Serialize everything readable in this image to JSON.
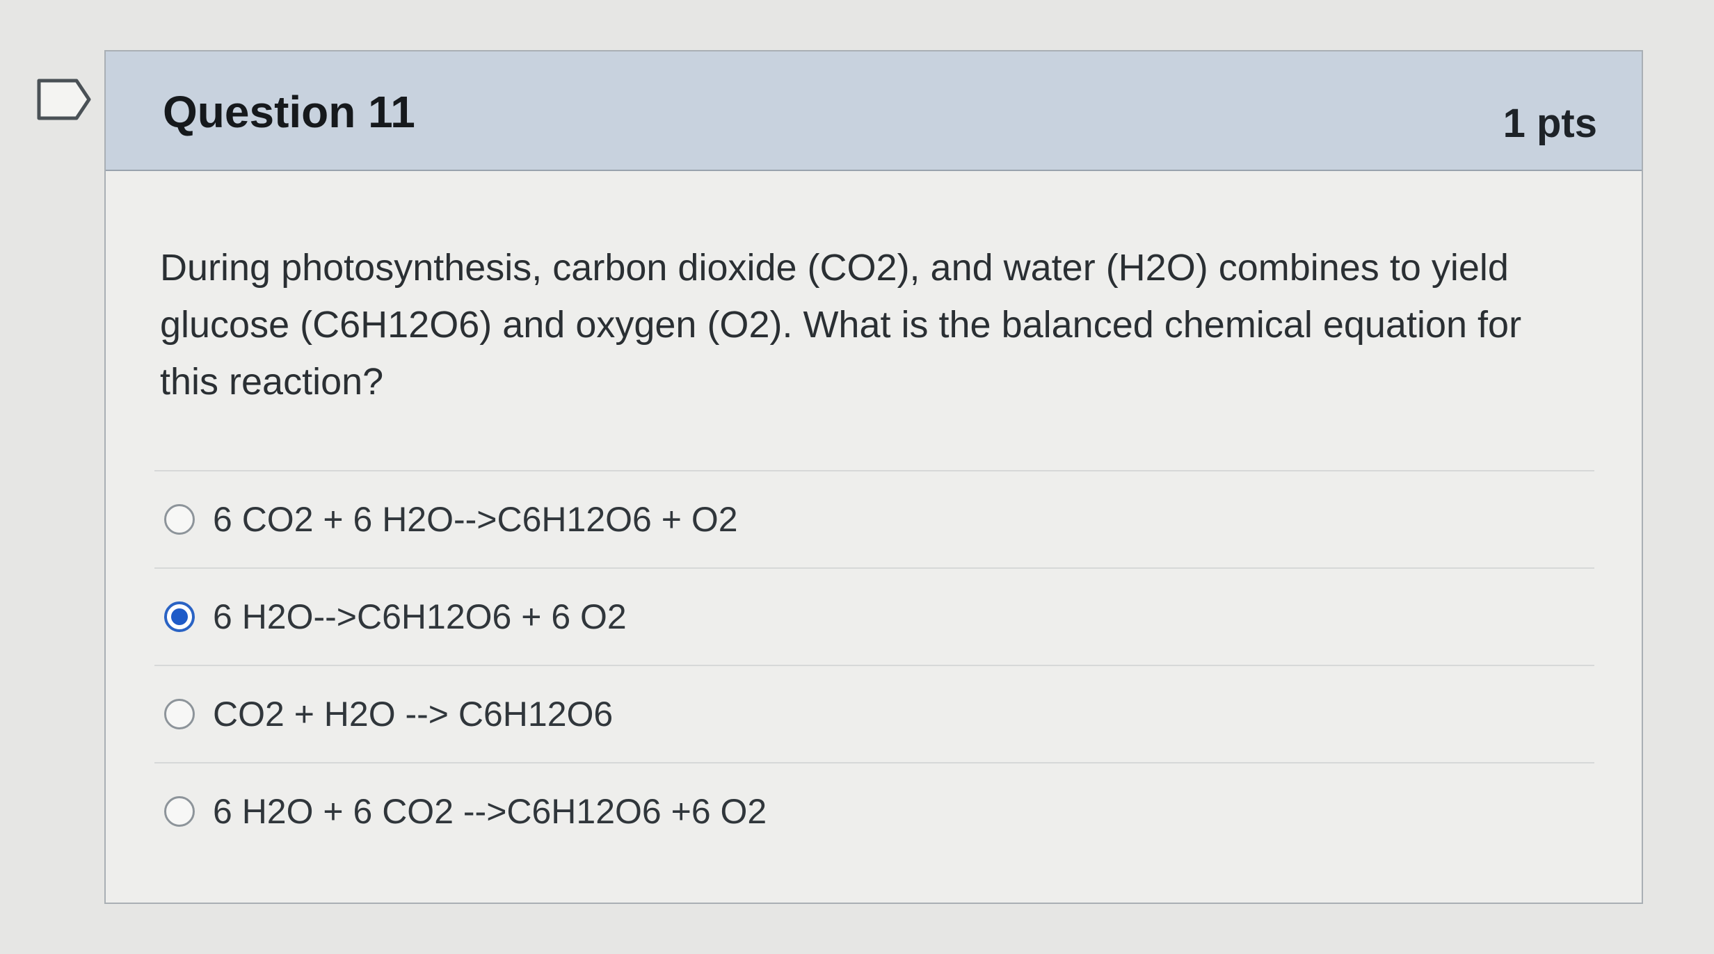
{
  "question": {
    "title": "Question 11",
    "points": "1 pts",
    "text": "During photosynthesis, carbon dioxide (CO2), and water (H2O) combines to yield glucose (C6H12O6) and oxygen (O2). What is the balanced chemical equation for this reaction?",
    "answers": [
      {
        "label": "6 CO2 + 6 H2O-->C6H12O6 + O2",
        "selected": false
      },
      {
        "label": "6 H2O-->C6H12O6 + 6 O2",
        "selected": true
      },
      {
        "label": "CO2 + H2O --> C6H12O6",
        "selected": false
      },
      {
        "label": "6 H2O + 6 CO2 -->C6H12O6 +6 O2",
        "selected": false
      }
    ]
  },
  "colors": {
    "header_bg": "#c8d2de",
    "selected_radio": "#1f5bc8"
  },
  "icons": {
    "flag": "flag-question-icon"
  }
}
